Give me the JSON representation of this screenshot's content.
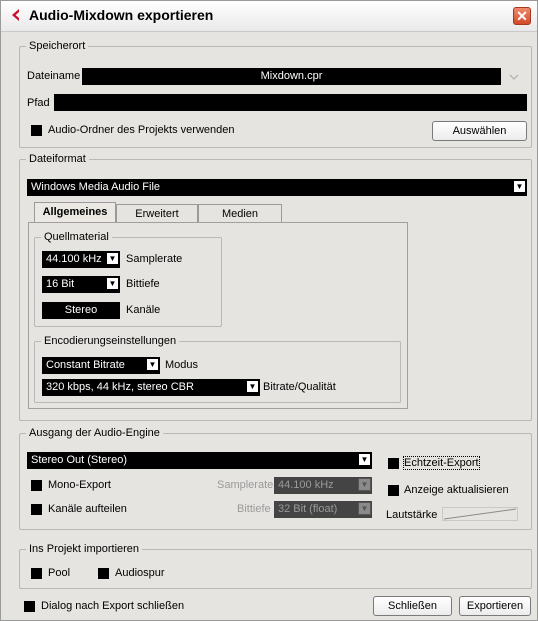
{
  "window": {
    "title": "Audio-Mixdown exportieren",
    "close_glyph": "✕"
  },
  "speicherort": {
    "legend": "Speicherort",
    "dateiname_label": "Dateiname",
    "dateiname_value": "Mixdown.cpr",
    "pfad_label": "Pfad",
    "pfad_value": "",
    "audio_ordner_label": "Audio-Ordner des Projekts verwenden",
    "auswaehlen_label": "Auswählen"
  },
  "dateiformat": {
    "legend": "Dateiformat",
    "format_value": "Windows Media Audio File",
    "tabs": [
      {
        "label": "Allgemeines",
        "active": true
      },
      {
        "label": "Erweitert",
        "active": false
      },
      {
        "label": "Medien",
        "active": false
      }
    ],
    "quellmaterial": {
      "legend": "Quellmaterial",
      "samplerate_value": "44.100 kHz",
      "samplerate_label": "Samplerate",
      "bittiefe_value": "16 Bit",
      "bittiefe_label": "Bittiefe",
      "kanaele_value": "Stereo",
      "kanaele_label": "Kanäle"
    },
    "encodierung": {
      "legend": "Encodierungseinstellungen",
      "modus_value": "Constant Bitrate",
      "modus_label": "Modus",
      "bitrate_value": "320 kbps, 44 kHz, stereo CBR",
      "bitrate_label": "Bitrate/Qualität"
    }
  },
  "ausgang": {
    "legend": "Ausgang der Audio-Engine",
    "output_value": "Stereo Out (Stereo)",
    "mono_export_label": "Mono-Export",
    "kanaele_aufteilen_label": "Kanäle aufteilen",
    "samplerate_label": "Samplerate",
    "samplerate_value": "44.100 kHz",
    "bittiefe_label": "Bittiefe",
    "bittiefe_value": "32 Bit (float)",
    "echtzeit_label": "Echtzeit-Export",
    "anzeige_label": "Anzeige aktualisieren",
    "lautstaerke_label": "Lautstärke"
  },
  "projekt": {
    "legend": "Ins Projekt importieren",
    "pool_label": "Pool",
    "audiospur_label": "Audiospur"
  },
  "footer": {
    "dialog_schliessen_label": "Dialog nach Export schließen",
    "schliessen_label": "Schließen",
    "exportieren_label": "Exportieren"
  },
  "icons": {
    "logo": "cubase-logo-icon",
    "dropdown": "chevron-down-icon",
    "close": "close-icon"
  }
}
